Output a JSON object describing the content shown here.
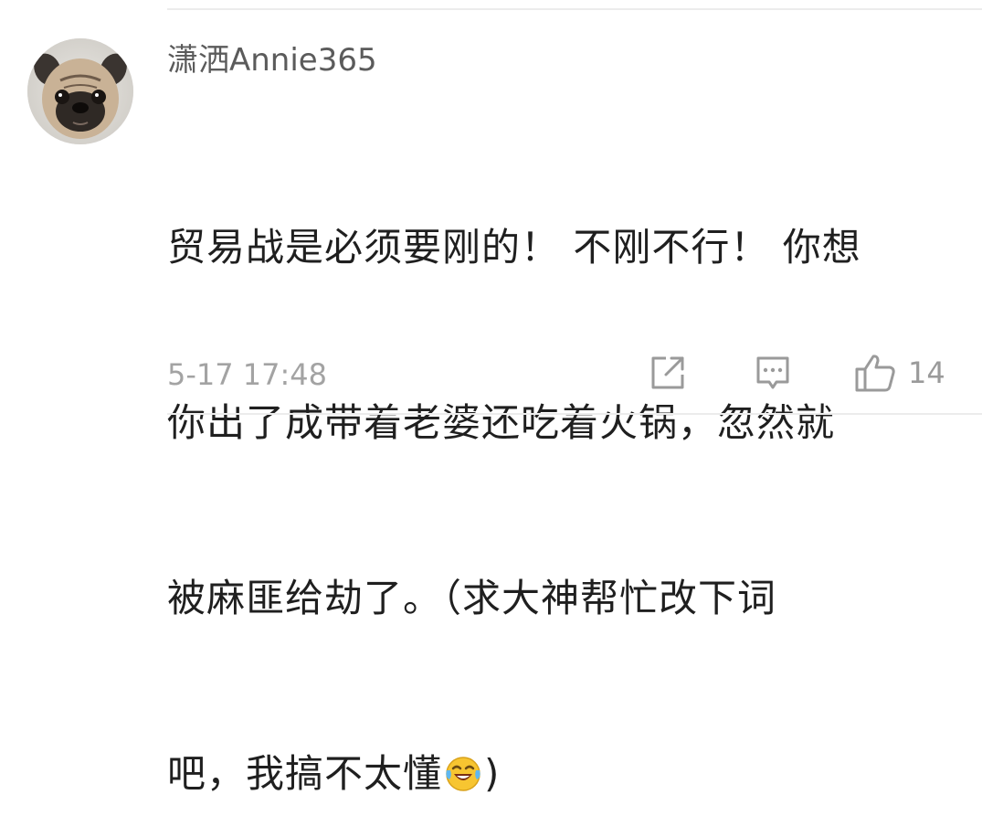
{
  "comment": {
    "username": "潇洒Annie365",
    "lines": [
      "贸易战是必须要刚的！ 不刚不行！ 你想",
      "你出了成带着老婆还吃着火锅，忽然就",
      "被麻匪给劫了。（求大神帮忙改下词",
      "吧，我搞不太懂"
    ],
    "closing_paren": ")",
    "inline_emoji": "laughing-with-tears-icon",
    "timestamp": "5-17 17:48",
    "like_count": "14"
  },
  "icons": {
    "avatar": "pug-dog-avatar",
    "share": "share-icon",
    "reply": "comment-reply-icon",
    "like": "thumbs-up-icon"
  },
  "colors": {
    "username": "#5b5b5b",
    "text": "#1f1f1f",
    "meta": "#a3a3a3",
    "icon": "#9a9a9a",
    "divider": "#ececec",
    "emoji_face": "#f7c531"
  }
}
